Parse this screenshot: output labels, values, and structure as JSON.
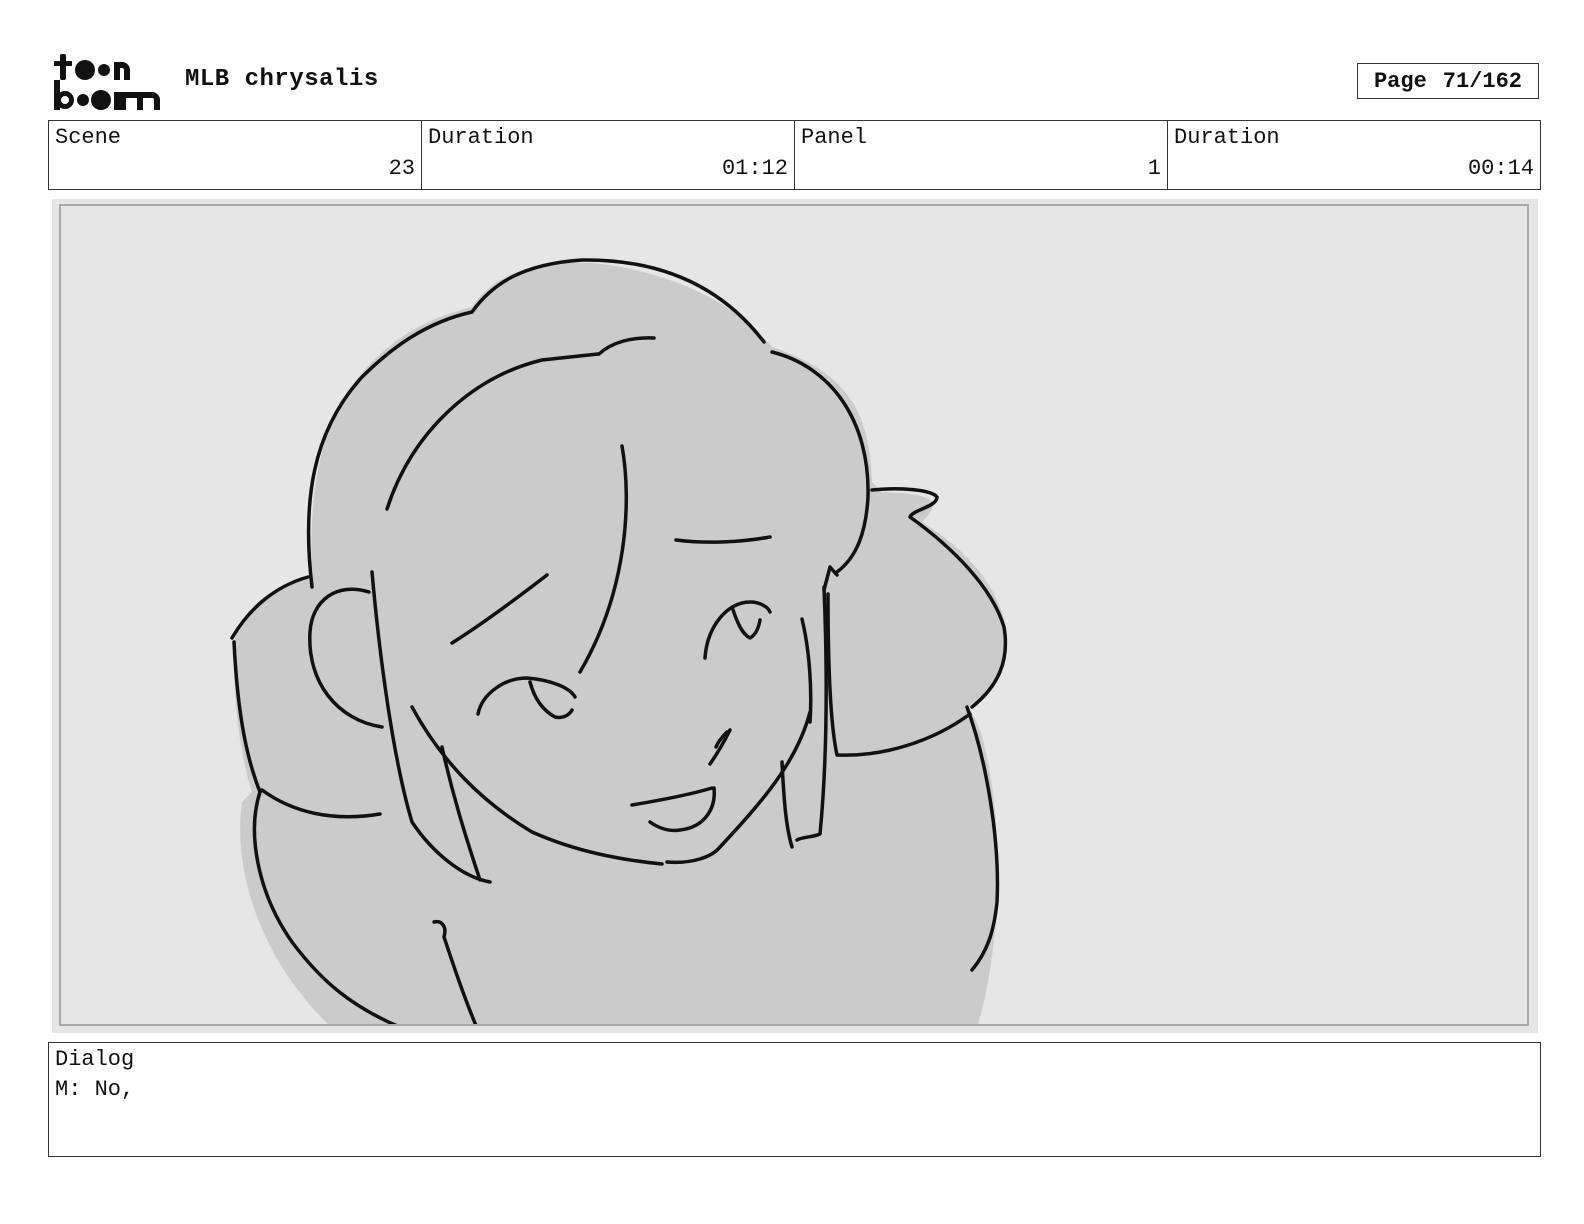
{
  "header": {
    "logo_text_top": "toon",
    "logo_text_bottom": "boom",
    "project_title": "MLB chrysalis",
    "page_label": "Page",
    "page_value": "71/162"
  },
  "info": {
    "scene_label": "Scene",
    "scene_value": "23",
    "scene_duration_label": "Duration",
    "scene_duration_value": "01:12",
    "panel_label": "Panel",
    "panel_value": "1",
    "panel_duration_label": "Duration",
    "panel_duration_value": "00:14"
  },
  "dialog": {
    "label": "Dialog",
    "text": "M: No,"
  },
  "colors": {
    "panel_background": "#e6e6e6",
    "character_fill": "#cbcbcb",
    "line": "#111111"
  }
}
